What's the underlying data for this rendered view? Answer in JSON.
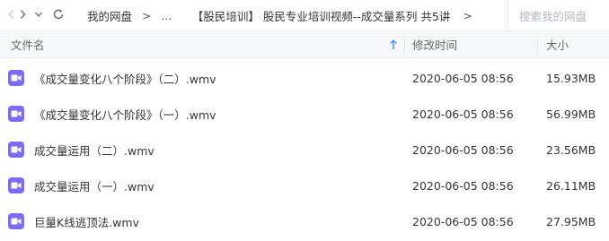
{
  "toolbar": {
    "breadcrumb": [
      {
        "label": "我的网盘"
      },
      {
        "label": "..."
      },
      {
        "label": "【股民培训】 股民专业培训视频--成交量系列 共5讲"
      }
    ],
    "separator": ">",
    "search_placeholder": "搜索我的网盘"
  },
  "table": {
    "columns": {
      "name": "文件名",
      "modified": "修改时间",
      "size": "大小"
    },
    "sort_icon": "arrow-up-icon",
    "rows": [
      {
        "icon": "video-file-icon",
        "name": "《成交量变化八个阶段》（二）.wmv",
        "modified": "2020-06-05 08:56",
        "size": "15.93MB"
      },
      {
        "icon": "video-file-icon",
        "name": "《成交量变化八个阶段》（一）.wmv",
        "modified": "2020-06-05 08:56",
        "size": "56.99MB"
      },
      {
        "icon": "video-file-icon",
        "name": "成交量运用（二）.wmv",
        "modified": "2020-06-05 08:56",
        "size": "23.56MB"
      },
      {
        "icon": "video-file-icon",
        "name": "成交量运用（一）.wmv",
        "modified": "2020-06-05 08:56",
        "size": "26.11MB"
      },
      {
        "icon": "video-file-icon",
        "name": "巨量K线逃顶法.wmv",
        "modified": "2020-06-05 08:56",
        "size": "27.95MB"
      }
    ]
  },
  "colors": {
    "accent": "#3b8cff",
    "file_icon": "#7b6cf6",
    "header_bg": "#f7f8fa"
  }
}
